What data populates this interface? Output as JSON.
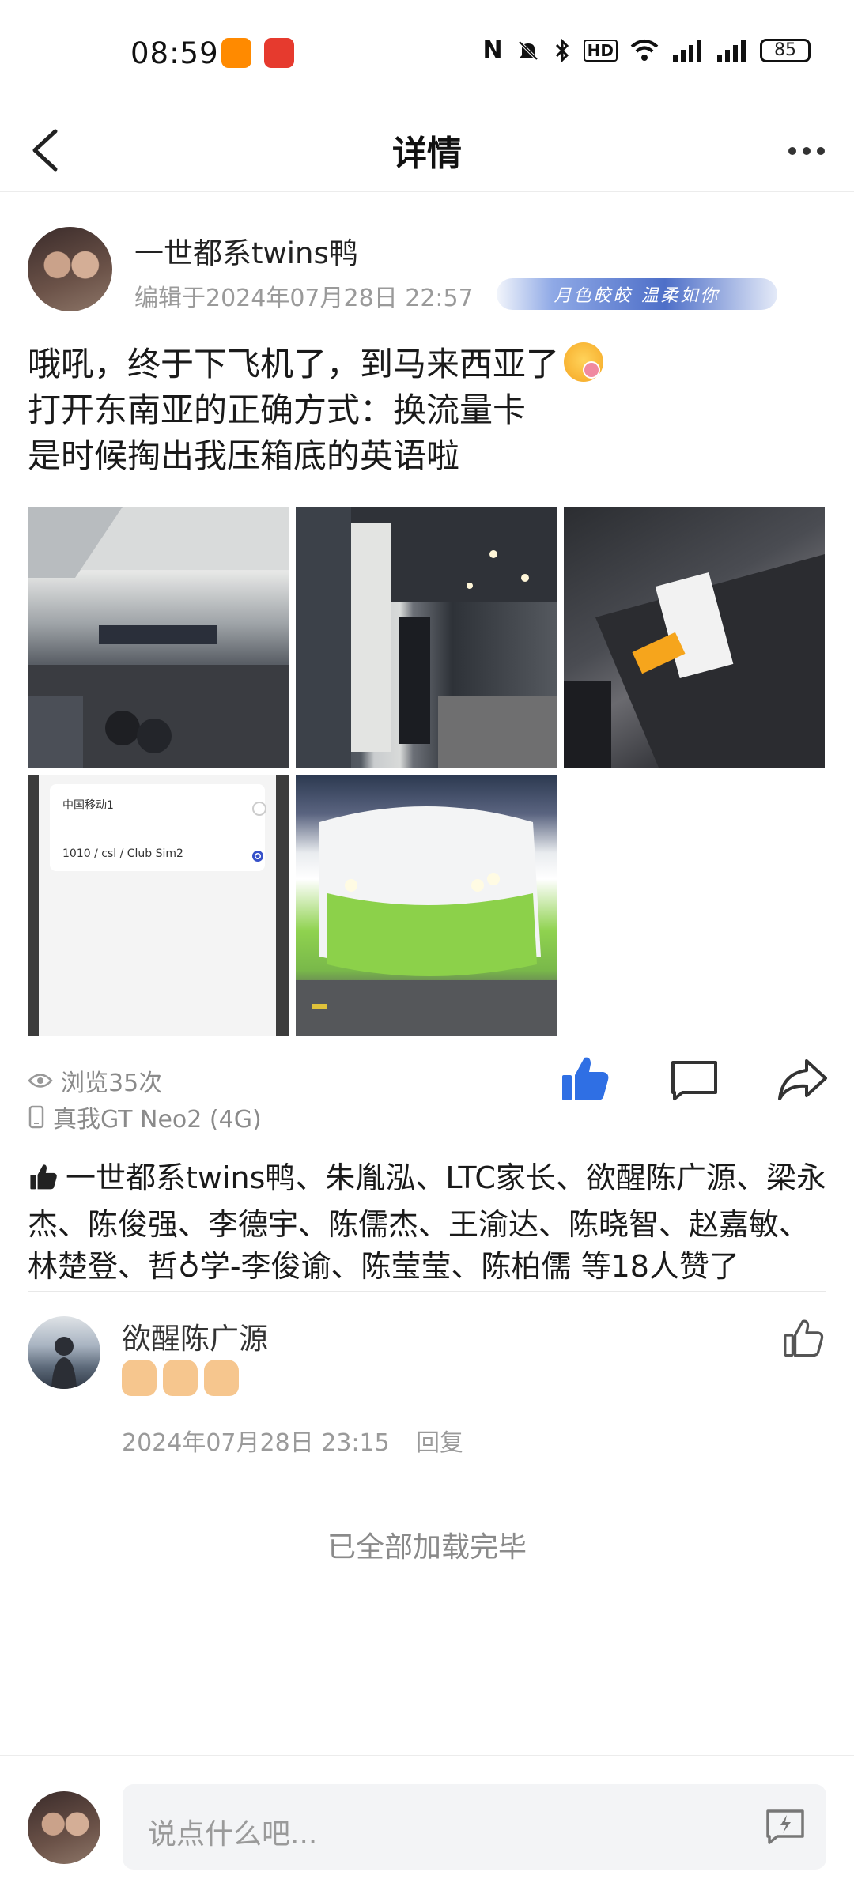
{
  "status_bar": {
    "time": "08:59",
    "icons": [
      "nfc-icon",
      "mute-icon",
      "bluetooth-icon",
      "hd-icon",
      "wifi-icon",
      "4g-signal-icon",
      "5g-signal-icon"
    ],
    "battery": "85"
  },
  "header": {
    "title": "详情"
  },
  "post": {
    "author": "一世都系twins鸭",
    "edit_time": "编辑于2024年07月28日 22:57",
    "badge_text": "月色皎皎  温柔如你",
    "lines": [
      "哦吼，终于下飞机了，到马来西亚了",
      "打开东南亚的正确方式：换流量卡",
      "是时候掏出我压箱底的英语啦"
    ],
    "images": [
      {
        "name": "airport-arrival-hall"
      },
      {
        "name": "airport-corridor"
      },
      {
        "name": "luggage-with-sim-card"
      },
      {
        "name": "sim-card-settings-screenshot",
        "line1": "中国移动1",
        "line2": "1010 / csl / Club Sim2"
      },
      {
        "name": "green-bus"
      }
    ],
    "views": "浏览35次",
    "device": "真我GT Neo2 (4G)"
  },
  "likes": {
    "text": "一世都系twins鸭、朱胤泓、LTC家长、欲醒陈广源、梁永杰、陈俊强、李德宇、陈儒杰、王渝达、陈晓智、赵嘉敏、林楚登、哲♁学-李俊谕、陈莹莹、陈柏儒 等18人赞了"
  },
  "comments": [
    {
      "name": "欲醒陈广源",
      "time": "2024年07月28日 23:15",
      "reply_label": "回复"
    }
  ],
  "footer": {
    "all_loaded": "已全部加载完毕",
    "input_placeholder": "说点什么吧..."
  },
  "colors": {
    "accent_blue": "#2f6fe4",
    "text_gray": "#8a8a8a"
  }
}
